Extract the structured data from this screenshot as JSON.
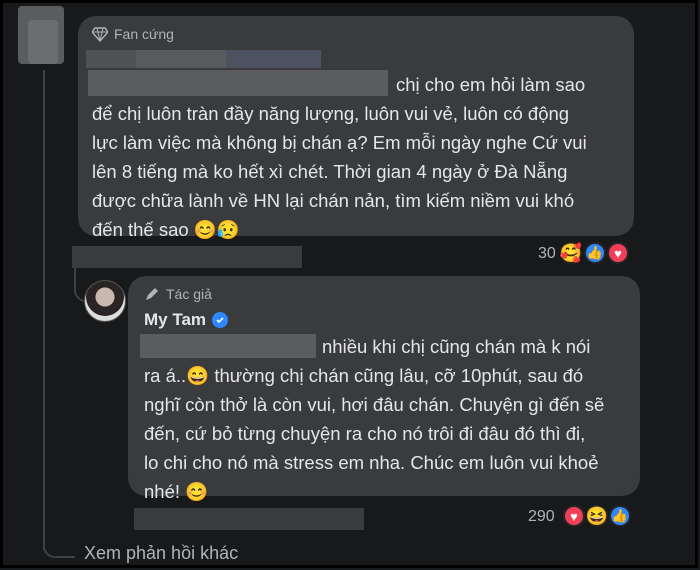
{
  "top_comment": {
    "badge_label": "Fan cứng",
    "text_lines": [
      "chị cho em hỏi làm sao",
      "để chị luôn tràn đầy năng lượng, luôn vui vẻ, luôn có động",
      "lực làm việc mà không bị chán ạ? Em mỗi ngày nghe Cứ vui",
      "lên 8 tiếng mà ko hết xì chét. Thời gian 4 ngày ở Đà Nẵng",
      "được chữa lành về HN lại chán nản, tìm kiếm niềm vui khó",
      "đến thế sao 😊😥"
    ],
    "reaction_count": "30",
    "reaction_icons": [
      "care-emoji",
      "like-icon",
      "love-icon"
    ]
  },
  "reply": {
    "badge_label": "Tác giả",
    "author_name": "My Tam",
    "verified": true,
    "text_lines": [
      "nhiều khi chị cũng chán mà k nói",
      "ra á..😄 thường chị chán cũng lâu, cỡ 10phút, sau đó",
      "nghĩ còn thở là còn vui, hơi đâu chán. Chuyện gì đến sẽ",
      "đến, cứ bỏ từng chuyện ra cho nó trôi đi đâu đó thì đi,",
      "lo chi cho nó mà stress em nha. Chúc em luôn vui khoẻ",
      "nhé! 😊"
    ],
    "reaction_count": "290",
    "reaction_icons": [
      "love-icon",
      "haha-emoji",
      "like-icon"
    ]
  },
  "more_replies_label": "Xem phản hồi khác",
  "colors": {
    "background": "#18191a",
    "bubble": "#3a3b3c",
    "text": "#e4e6eb",
    "secondary_text": "#b0b3b8",
    "like_blue": "#2d88ff",
    "love_red": "#f33e58"
  }
}
